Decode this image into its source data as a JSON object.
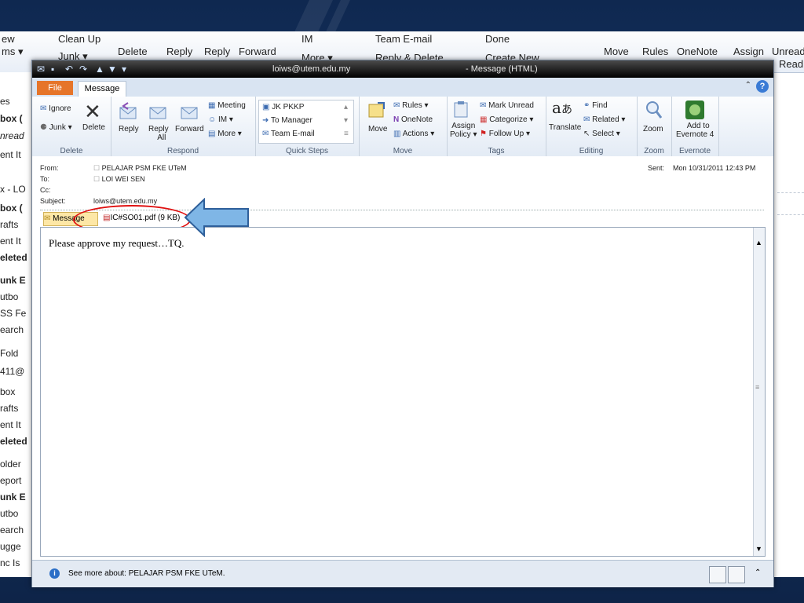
{
  "background_app": {
    "ribbon": {
      "clean_up": "Clean Up",
      "junk": "Junk ▾",
      "delete": "Delete",
      "reply": "Reply",
      "reply_all": "Reply",
      "forward": "Forward",
      "im": "IM",
      "more": "More ▾",
      "team_email": "Team E-mail",
      "reply_delete": "Reply & Delete",
      "done": "Done",
      "create_new": "Create New",
      "move": "Move",
      "rules": "Rules",
      "onenote": "OneNote",
      "assign": "Assign",
      "unread": "Unread",
      "read": "Read",
      "view_items_1": "ew",
      "view_items_2": "ms ▾"
    },
    "folder_pane": [
      "es",
      "box (",
      "nread",
      "ent It",
      "x - LO",
      "box (",
      "rafts",
      "ent It",
      "eleted",
      "unk E",
      "utbo",
      "SS Fe",
      "earch",
      "Fold",
      "411@",
      "box",
      "rafts",
      "ent It",
      "eleted",
      "older",
      "eport",
      "unk E",
      "utbo",
      "earch",
      "ugge",
      "nc Is"
    ]
  },
  "window": {
    "title_email": "loiws@utem.edu.my",
    "title_suffix": "- Message (HTML)"
  },
  "tabs": {
    "file": "File",
    "message": "Message"
  },
  "ribbon": {
    "delete_group": {
      "label": "Delete",
      "ignore": "Ignore",
      "junk": "Junk ▾",
      "delete": "Delete"
    },
    "respond_group": {
      "label": "Respond",
      "reply": "Reply",
      "reply_all": "Reply\nAll",
      "reply_all_line1": "Reply",
      "reply_all_line2": "All",
      "forward": "Forward",
      "meeting": "Meeting",
      "im": "IM ▾",
      "more": "More ▾"
    },
    "quick_steps": {
      "label": "Quick Steps",
      "items": [
        "JK PKKP",
        "To Manager",
        "Team E-mail"
      ]
    },
    "move_group": {
      "label": "Move",
      "move": "Move",
      "rules": "Rules ▾",
      "onenote": "OneNote",
      "actions": "Actions ▾"
    },
    "tags_group": {
      "label": "Tags",
      "assign_policy_1": "Assign",
      "assign_policy_2": "Policy ▾",
      "mark_unread": "Mark Unread",
      "categorize": "Categorize ▾",
      "follow_up": "Follow Up ▾"
    },
    "editing_group": {
      "label": "Editing",
      "translate": "Translate",
      "find": "Find",
      "related": "Related ▾",
      "select": "Select ▾"
    },
    "zoom_group": {
      "label": "Zoom",
      "zoom": "Zoom"
    },
    "evernote_group": {
      "label": "Evernote",
      "add_1": "Add to",
      "add_2": "Evernote 4"
    }
  },
  "header": {
    "from_label": "From:",
    "from_value": "PELAJAR PSM FKE UTeM",
    "to_label": "To:",
    "to_value": "LOI WEI SEN",
    "cc_label": "Cc:",
    "subject_label": "Subject:",
    "subject_value": "loiws@utem.edu.my",
    "sent_label": "Sent:",
    "sent_value": "Mon 10/31/2011 12:43 PM"
  },
  "attachments": {
    "message_label": "Message",
    "file": "IC#SO01.pdf (9 KB)"
  },
  "body": {
    "text": "Please approve my request…TQ."
  },
  "footer": {
    "text": "See more about: PELAJAR PSM FKE UTeM."
  }
}
